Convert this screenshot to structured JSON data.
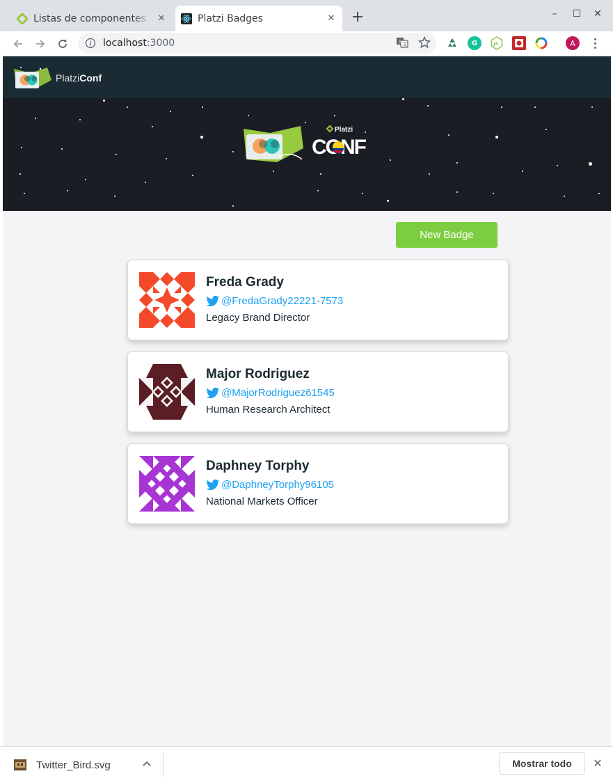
{
  "browser": {
    "tabs": [
      {
        "title": "Listas de componentes en React",
        "active": false,
        "icon": "platzi-icon"
      },
      {
        "title": "Platzi Badges",
        "active": true,
        "icon": "react-icon"
      }
    ],
    "address": {
      "host": "localhost",
      "port": ":3000"
    },
    "window_controls": {
      "minimize": "–",
      "maximize": "☐",
      "close": "✕"
    },
    "extensions": [
      "recycle-icon",
      "grammarly-icon",
      "nodejs-icon",
      "pesticide-icon",
      "colorpick-icon"
    ],
    "profile_initial": "A"
  },
  "site": {
    "brand_light": "Platzi",
    "brand_bold": "Conf",
    "hero_logo": {
      "small": "Platzi",
      "big": "CONF"
    },
    "new_badge_label": "New Badge",
    "accent_color": "#7dcd40",
    "twitter_color": "#1da1f2"
  },
  "badges": [
    {
      "name": "Freda Grady",
      "twitter": "@FredaGrady22221-7573",
      "job": "Legacy Brand Director",
      "avatar_color": "#f54a2a"
    },
    {
      "name": "Major Rodriguez",
      "twitter": "@MajorRodriguez61545",
      "job": "Human Research Architect",
      "avatar_color": "#5b1e25"
    },
    {
      "name": "Daphney Torphy",
      "twitter": "@DaphneyTorphy96105",
      "job": "National Markets Officer",
      "avatar_color": "#a735d3"
    }
  ],
  "downloads": {
    "file_name": "Twitter_Bird.svg",
    "show_all_label": "Mostrar todo",
    "close": "✕"
  }
}
